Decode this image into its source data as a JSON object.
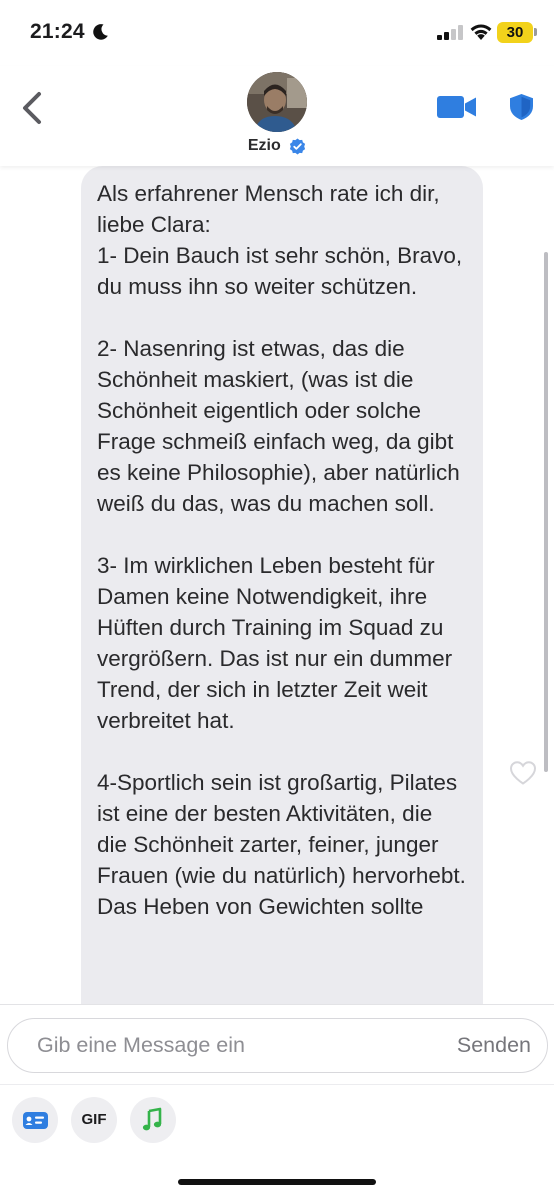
{
  "status_bar": {
    "time": "21:24",
    "battery": "30"
  },
  "header": {
    "contact_name": "Ezio",
    "verified": true
  },
  "message": {
    "text": "Als erfahrener Mensch rate ich dir, liebe Clara:\n1- Dein Bauch ist sehr schön, Bravo, du muss ihn so weiter schützen.\n\n2- Nasenring ist etwas, das die Schönheit maskiert, (was ist die Schönheit eigentlich oder solche Frage schmeiß einfach weg, da gibt es keine Philosophie), aber natürlich weiß du das, was du machen soll.\n\n3- Im wirklichen Leben besteht für Damen keine Notwendigkeit, ihre Hüften durch Training im Squad zu vergrößern. Das ist nur ein dummer Trend, der sich in letzter Zeit weit verbreitet hat.\n\n4-Sportlich sein ist großartig, Pilates ist eine der besten Aktivitäten, die die Schönheit zarter, feiner, junger Frauen (wie du natürlich) hervorhebt. Das Heben von Gewichten sollte"
  },
  "composer": {
    "placeholder": "Gib eine Message ein",
    "send_label": "Senden"
  },
  "toolbar": {
    "gif_label": "GIF"
  },
  "colors": {
    "accent": "#2f7ee0",
    "bubble": "#ebebef",
    "battery": "#f2d21b",
    "music": "#34b34a"
  },
  "icons": [
    "moon-icon",
    "signal-icon",
    "wifi-icon",
    "battery-icon",
    "back-chevron-icon",
    "verified-icon",
    "video-call-icon",
    "shield-icon",
    "heart-icon",
    "card-icon",
    "music-note-icon"
  ]
}
